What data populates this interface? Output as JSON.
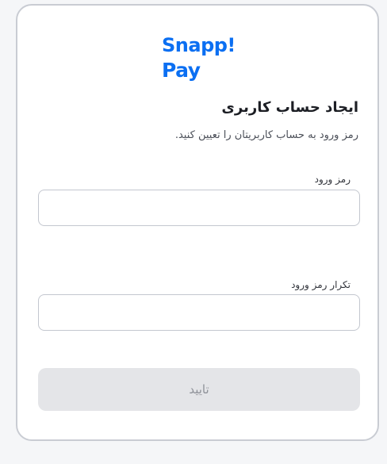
{
  "brand": {
    "line1": "Snapp!",
    "line2": "Pay",
    "color": "#0b6ff2"
  },
  "form": {
    "title": "ایجاد حساب کاربری",
    "subtitle": "رمز ورود به حساب کاربریتان را تعیین کنید.",
    "password_label": "رمز ورود",
    "password_value": "",
    "confirm_label": "تکرار رمز ورود",
    "confirm_value": "",
    "submit_label": "تایید",
    "submit_disabled": true
  }
}
